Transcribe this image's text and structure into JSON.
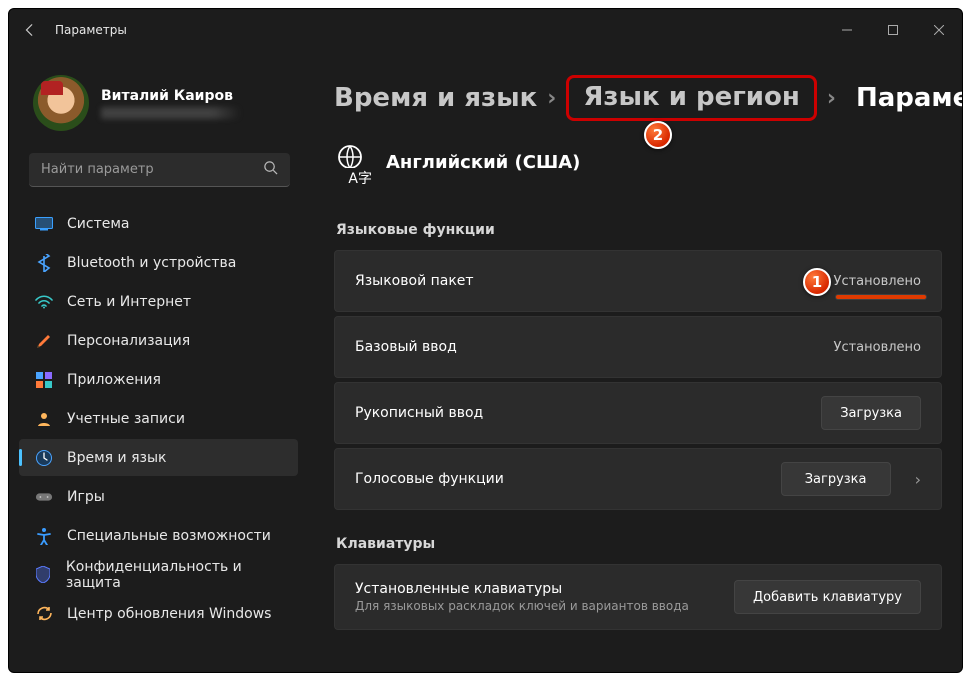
{
  "app_title": "Параметры",
  "user": {
    "name": "Виталий Каиров"
  },
  "search": {
    "placeholder": "Найти параметр"
  },
  "sidebar": {
    "items": [
      {
        "label": "Система",
        "icon": "system"
      },
      {
        "label": "Bluetooth и устройства",
        "icon": "bluetooth"
      },
      {
        "label": "Сеть и Интернет",
        "icon": "wifi"
      },
      {
        "label": "Персонализация",
        "icon": "brush"
      },
      {
        "label": "Приложения",
        "icon": "apps"
      },
      {
        "label": "Учетные записи",
        "icon": "person"
      },
      {
        "label": "Время и язык",
        "icon": "clock"
      },
      {
        "label": "Игры",
        "icon": "games"
      },
      {
        "label": "Специальные возможности",
        "icon": "access"
      },
      {
        "label": "Конфиденциальность и защита",
        "icon": "shield"
      },
      {
        "label": "Центр обновления Windows",
        "icon": "update"
      }
    ],
    "active_index": 6
  },
  "breadcrumb": {
    "a": "Время и язык",
    "b": "Язык и регион",
    "c": "Параметры"
  },
  "language_header": "Английский (США)",
  "section_features": "Языковые функции",
  "features": [
    {
      "label": "Языковой пакет",
      "status": "Установлено",
      "kind": "text"
    },
    {
      "label": "Базовый ввод",
      "status": "Установлено",
      "kind": "text"
    },
    {
      "label": "Рукописный ввод",
      "status": "Загрузка",
      "kind": "button"
    },
    {
      "label": "Голосовые функции",
      "status": "Загрузка",
      "kind": "button_chev"
    }
  ],
  "section_keyboards": "Клавиатуры",
  "keyboards_row": {
    "title": "Установленные клавиатуры",
    "subtitle": "Для языковых раскладок ключей и вариантов ввода",
    "button": "Добавить клавиатуру"
  },
  "annotations": {
    "one": "1",
    "two": "2"
  }
}
